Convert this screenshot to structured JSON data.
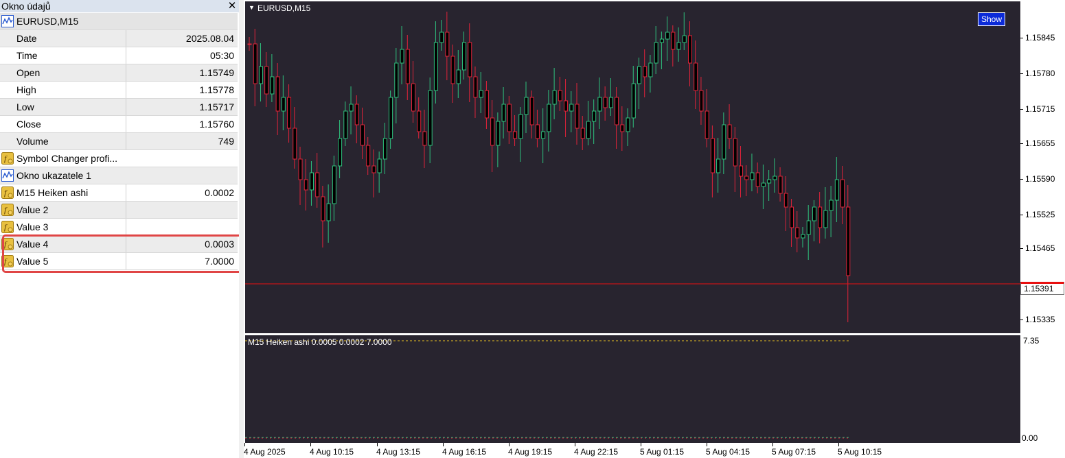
{
  "data_window": {
    "title": "Okno údajů",
    "symbol_row": "EURUSD,M15",
    "rows": [
      {
        "label": "Date",
        "value": "2025.08.04"
      },
      {
        "label": "Time",
        "value": "05:30"
      },
      {
        "label": "Open",
        "value": "1.15749"
      },
      {
        "label": "High",
        "value": "1.15778"
      },
      {
        "label": "Low",
        "value": "1.15717"
      },
      {
        "label": "Close",
        "value": "1.15760"
      },
      {
        "label": "Volume",
        "value": "749"
      }
    ],
    "indicator_rows": [
      {
        "label": "Symbol Changer profi...",
        "value": "",
        "icon": "indicator-f-icon"
      },
      {
        "label": "Okno ukazatele 1",
        "value": "",
        "icon": "chart-window-icon"
      },
      {
        "label": "M15 Heiken ashi",
        "value": "0.0002",
        "icon": "indicator-f-icon"
      },
      {
        "label": "Value 2",
        "value": "",
        "icon": "indicator-f-icon"
      },
      {
        "label": "Value 3",
        "value": "",
        "icon": "indicator-f-icon"
      },
      {
        "label": "Value 4",
        "value": "0.0003",
        "icon": "indicator-f-icon"
      },
      {
        "label": "Value 5",
        "value": "7.0000",
        "icon": "indicator-f-icon"
      }
    ]
  },
  "chart": {
    "symbol": "EURUSD,M15",
    "show_button": "Show",
    "indicator_label": "M15 Heiken ashi  0.0005 0.0002 7.0000",
    "price_axis": [
      "1.15845",
      "1.15780",
      "1.15715",
      "1.15655",
      "1.15590",
      "1.15525",
      "1.15465",
      "1.15391",
      "1.15335"
    ],
    "indicator_axis_top": "7.35",
    "indicator_axis_bottom": "0.00",
    "time_axis": [
      "4 Aug 2025",
      "4 Aug 10:15",
      "4 Aug 13:15",
      "4 Aug 16:15",
      "4 Aug 19:15",
      "4 Aug 22:15",
      "5 Aug 01:15",
      "5 Aug 04:15",
      "5 Aug 07:15",
      "5 Aug 10:15"
    ],
    "last_price": "1.15391",
    "colors": {
      "background": "#28242f",
      "bull": "#2ec27e",
      "bear": "#e0233a",
      "price_line": "#e81010",
      "level_line": "#e8c020"
    }
  }
}
